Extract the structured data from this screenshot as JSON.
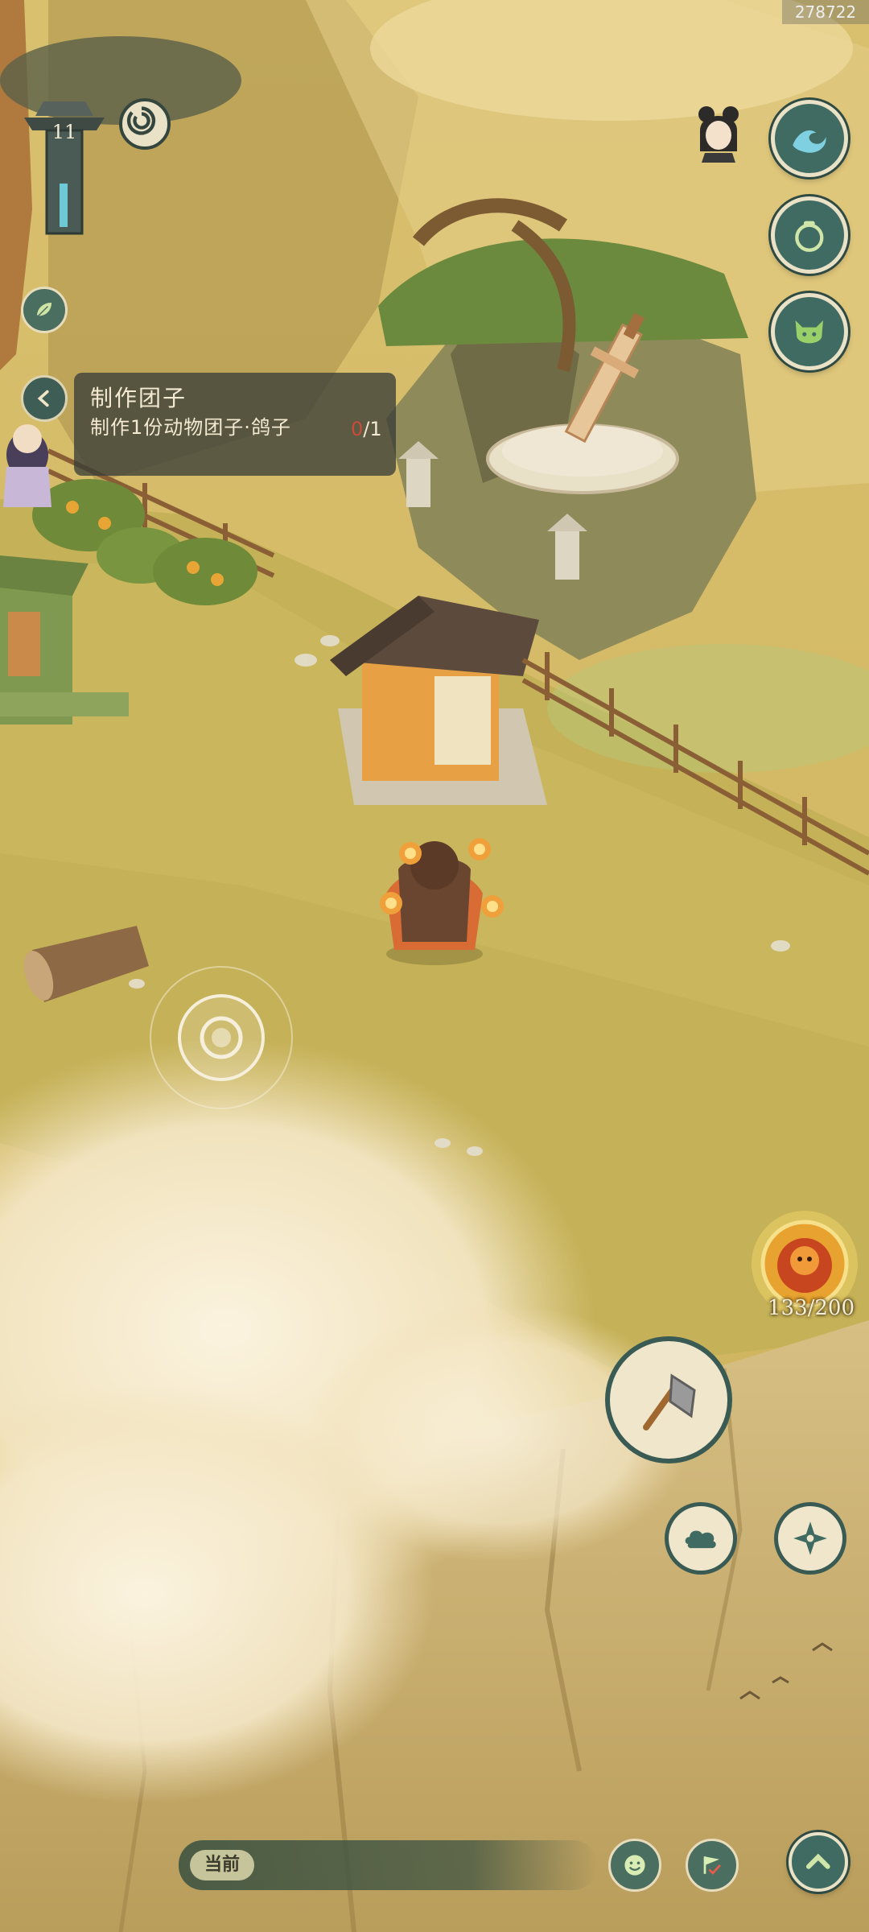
{
  "watermark": {
    "id_text": "278722"
  },
  "player": {
    "level": "11"
  },
  "quest": {
    "title": "制作团子",
    "description": "制作1份动物团子·鸽子",
    "progress_current": "0",
    "progress_total": "/1"
  },
  "stamina": {
    "text": "133/200",
    "current": 133,
    "max": 200
  },
  "chat": {
    "channel_label": "当前"
  },
  "colors": {
    "button_teal": "#3f6b62",
    "button_rim": "#e9e2c6",
    "panel_bg": "#3a3e38",
    "grass": "#c6b45a",
    "progress_red": "#c94b3a"
  },
  "icons": {
    "top_right": [
      "character-portrait-icon",
      "wave-skill-icon",
      "pouch-bag-icon",
      "monster-mask-icon"
    ],
    "left": [
      "level-pillar-icon",
      "spiral-menu-icon",
      "leaf-icon",
      "back-arrow-icon"
    ],
    "bottom_right": [
      "stamina-flame-icon",
      "axe-tool-icon",
      "cloud-skill-icon",
      "shuriken-skill-icon"
    ],
    "bottom_bar": [
      "emoji-face-icon",
      "flag-checkmark-icon",
      "chevron-up-icon"
    ]
  }
}
